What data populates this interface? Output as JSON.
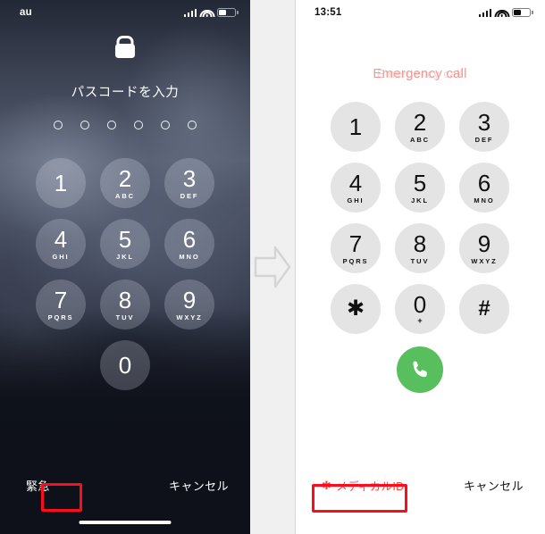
{
  "layout": {
    "left_panel_name": "iphone-lock-screen-passcode",
    "right_panel_name": "iphone-emergency-call-dialer",
    "transition_arrow": "arrow-right-icon"
  },
  "left_phone": {
    "status_bar": {
      "carrier": "au",
      "signal_icon": "cellular-signal-icon",
      "wifi_icon": "wifi-icon",
      "battery_icon": "battery-icon"
    },
    "lock_icon": "lock-closed-icon",
    "passcode_title": "パスコードを入力",
    "passcode_dots": 6,
    "keypad": [
      {
        "digit": "1",
        "letters": ""
      },
      {
        "digit": "2",
        "letters": "ABC"
      },
      {
        "digit": "3",
        "letters": "DEF"
      },
      {
        "digit": "4",
        "letters": "GHI"
      },
      {
        "digit": "5",
        "letters": "JKL"
      },
      {
        "digit": "6",
        "letters": "MNO"
      },
      {
        "digit": "7",
        "letters": "PQRS"
      },
      {
        "digit": "8",
        "letters": "TUV"
      },
      {
        "digit": "9",
        "letters": "WXYZ"
      },
      {
        "digit": "0",
        "letters": ""
      }
    ],
    "emergency_label": "緊急",
    "cancel_label": "キャンセル",
    "highlight_color": "#fc0d1b"
  },
  "right_phone": {
    "status_bar": {
      "time": "13:51",
      "signal_icon": "cellular-signal-icon",
      "wifi_icon": "wifi-icon",
      "battery_icon": "battery-icon"
    },
    "emergency_call_label": "Emergency call",
    "emergency_call_color": "#f08a86",
    "keypad": [
      {
        "digit": "1",
        "letters": ""
      },
      {
        "digit": "2",
        "letters": "ABC"
      },
      {
        "digit": "3",
        "letters": "DEF"
      },
      {
        "digit": "4",
        "letters": "GHI"
      },
      {
        "digit": "5",
        "letters": "JKL"
      },
      {
        "digit": "6",
        "letters": "MNO"
      },
      {
        "digit": "7",
        "letters": "PQRS"
      },
      {
        "digit": "8",
        "letters": "TUV"
      },
      {
        "digit": "9",
        "letters": "WXYZ"
      },
      {
        "digit": "✱",
        "letters": ""
      },
      {
        "digit": "0",
        "letters": "+"
      },
      {
        "digit": "#",
        "letters": ""
      }
    ],
    "call_button_icon": "phone-handset-icon",
    "call_button_color": "#57bf5e",
    "medical_id_star": "✱",
    "medical_id_label": "メディカルID",
    "medical_id_color": "#fc3d39",
    "cancel_label": "キャンセル",
    "highlight_color": "#fc0d1b"
  }
}
